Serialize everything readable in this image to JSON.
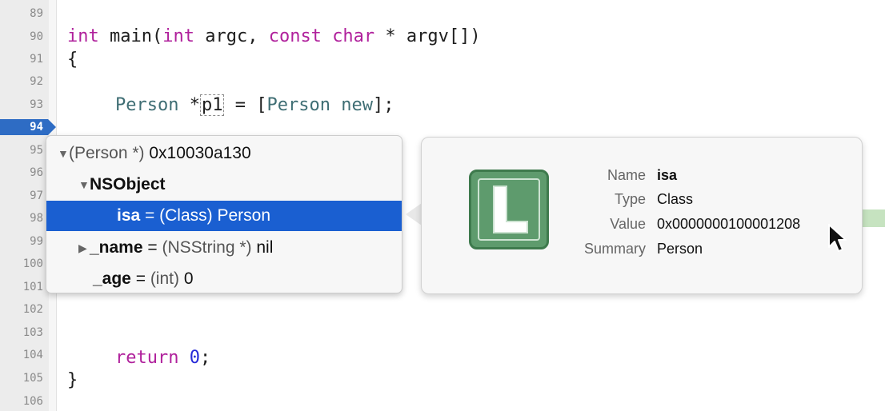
{
  "gutter": {
    "line_numbers": [
      "89",
      "90",
      "91",
      "92",
      "93",
      "94",
      "95",
      "96",
      "97",
      "98",
      "99",
      "100",
      "101",
      "102",
      "103",
      "104",
      "105",
      "106"
    ],
    "breakpoint_line": "94"
  },
  "code": {
    "line90": {
      "kw1": "int",
      "main": " main(",
      "kw2": "int",
      "argc": " argc, ",
      "kw3": "const",
      "rest": " ",
      "kw4": "char",
      "tail": " * argv[])"
    },
    "line91": "{",
    "line93": {
      "type1": "Person",
      "star": " *",
      "var": "p1",
      "eq": " = [",
      "type2": "Person",
      "sp": " ",
      "msg": "new",
      "end": "];"
    },
    "line104": {
      "kw": "return",
      "sp": " ",
      "num": "0",
      "end": ";"
    },
    "line105": "}"
  },
  "variables_popup": {
    "rows": [
      {
        "expander": "▼",
        "name": "",
        "type": "(Person *)",
        "value": "0x10030a130"
      },
      {
        "expander": "▼",
        "name": "NSObject",
        "type": "",
        "value": ""
      },
      {
        "expander": "",
        "name": "isa",
        "eq": " = ",
        "type": "(Class)",
        "value": "Person",
        "selected": true
      },
      {
        "expander": "▶",
        "name": "_name",
        "eq": " = ",
        "type": "(NSString *)",
        "value": "nil"
      },
      {
        "expander": "",
        "name": "_age",
        "eq": " = ",
        "type": "(int)",
        "value": "0"
      }
    ]
  },
  "detail_popup": {
    "icon": "local-variable-L-icon",
    "icon_letter": "L",
    "name_label": "Name",
    "name_value": "isa",
    "type_label": "Type",
    "type_value": "Class",
    "value_label": "Value",
    "value_value": "0x0000000100001208",
    "summary_label": "Summary",
    "summary_value": "Person"
  },
  "colors": {
    "selection": "#1a5fd1",
    "keyword": "#b0219c",
    "type": "#3f6e74",
    "number": "#272ad8",
    "breakpoint": "#2e6cc4",
    "icon_green": "#5e9b6d"
  }
}
